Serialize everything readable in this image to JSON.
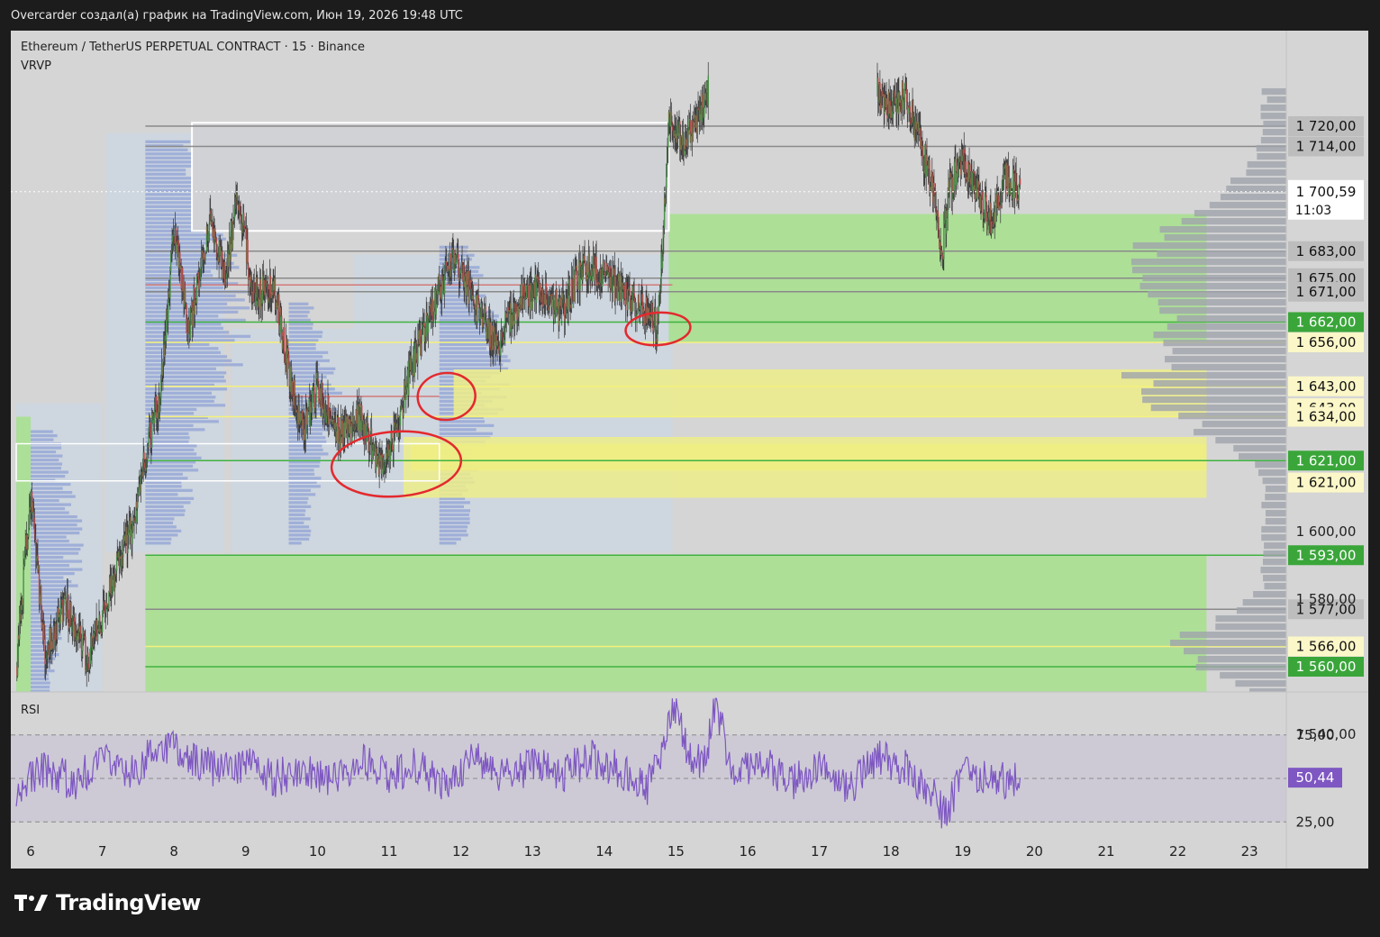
{
  "header": {
    "caption": "Overcarder создал(а) график на TradingView.com, Июн 19, 2026 19:48 UTC"
  },
  "legend": {
    "symbol": "Ethereum / TetherUS PERPETUAL CONTRACT · 15 · Binance",
    "indicator": "VRVP"
  },
  "rsi_panel": {
    "label": "RSI",
    "current_value": "50,44",
    "upper_level": "75,00",
    "lower_level": "25,00"
  },
  "footer": {
    "brand": "TradingView"
  },
  "colors": {
    "background": "#d5d5d5",
    "green_zone": "#a6e08c",
    "yellow_zone": "#eded8a",
    "bright_yellow": "#f3f25a",
    "volume_profile": "#8fa2d6",
    "rsi_line": "#7e57c2",
    "candle_up": "#4a8f4a",
    "candle_down": "#b34a4a",
    "annotation": "#e3292e"
  },
  "chart_data": [
    {
      "type": "candlestick",
      "title": "Ethereum / TetherUS PERPETUAL CONTRACT · 15 · Binance",
      "x_tick_labels": [
        "6",
        "7",
        "8",
        "9",
        "10",
        "11",
        "12",
        "13",
        "14",
        "15",
        "16",
        "17",
        "18",
        "19",
        "20",
        "21",
        "22",
        "23"
      ],
      "y_tick_labels": [
        "1 600,00",
        "1 580,00",
        "1 540,00"
      ],
      "ylim": [
        1530,
        1730
      ],
      "price_axis_labels": [
        {
          "value": 1720.0,
          "text": "1 720,00",
          "style": "gray"
        },
        {
          "value": 1714.0,
          "text": "1 714,00",
          "style": "gray"
        },
        {
          "value": 1683.0,
          "text": "1 683,00",
          "style": "gray"
        },
        {
          "value": 1675.0,
          "text": "1 675,00",
          "style": "gray"
        },
        {
          "value": 1671.0,
          "text": "1 671,00",
          "style": "gray"
        },
        {
          "value": 1662.0,
          "text": "1 662,00",
          "style": "green"
        },
        {
          "value": 1656.0,
          "text": "1 656,00",
          "style": "yellow"
        },
        {
          "value": 1643.0,
          "text": "1 643,00",
          "style": "yellow"
        },
        {
          "value": 1636.5,
          "text": "1 643,00",
          "style": "yellow"
        },
        {
          "value": 1634.0,
          "text": "1 634,00",
          "style": "yellow"
        },
        {
          "value": 1621.0,
          "text": "1 621,00",
          "style": "green"
        },
        {
          "value": 1614.5,
          "text": "1 621,00",
          "style": "yellow"
        },
        {
          "value": 1593.0,
          "text": "1 593,00",
          "style": "green"
        },
        {
          "value": 1577.0,
          "text": "1 577,00",
          "style": "gray"
        },
        {
          "value": 1566.0,
          "text": "1 566,00",
          "style": "yellow"
        },
        {
          "value": 1560.0,
          "text": "1 560,00",
          "style": "green"
        }
      ],
      "last_price": {
        "value": 1700.59,
        "text": "1 700,59",
        "countdown": "11:03"
      },
      "zones": [
        {
          "color": "green",
          "from_day": 14.9,
          "to_day": 22.4,
          "low": 1656,
          "high": 1694
        },
        {
          "color": "yellow",
          "from_day": 11.9,
          "to_day": 22.4,
          "low": 1634,
          "high": 1648
        },
        {
          "color": "bright_yellow",
          "from_day": 11.3,
          "to_day": 22.4,
          "low": 1618,
          "high": 1626
        },
        {
          "color": "yellow",
          "from_day": 11.2,
          "to_day": 22.4,
          "low": 1610,
          "high": 1628
        },
        {
          "color": "green",
          "from_day": 7.6,
          "to_day": 22.4,
          "low": 1547,
          "high": 1593
        },
        {
          "color": "green",
          "from_day": 5.8,
          "to_day": 6.0,
          "low": 1549,
          "high": 1634
        }
      ],
      "horizontal_levels": [
        1720,
        1714,
        1683,
        1675,
        1671,
        1662,
        1656,
        1643,
        1634,
        1621,
        1593,
        1577,
        1566,
        1560
      ],
      "price_path": [
        {
          "day": 5.8,
          "price": 1560
        },
        {
          "day": 6.0,
          "price": 1610
        },
        {
          "day": 6.2,
          "price": 1565
        },
        {
          "day": 6.5,
          "price": 1578
        },
        {
          "day": 6.8,
          "price": 1562
        },
        {
          "day": 7.0,
          "price": 1575
        },
        {
          "day": 7.2,
          "price": 1590
        },
        {
          "day": 7.4,
          "price": 1600
        },
        {
          "day": 7.6,
          "price": 1622
        },
        {
          "day": 7.8,
          "price": 1640
        },
        {
          "day": 8.0,
          "price": 1690
        },
        {
          "day": 8.2,
          "price": 1660
        },
        {
          "day": 8.5,
          "price": 1692
        },
        {
          "day": 8.7,
          "price": 1675
        },
        {
          "day": 8.9,
          "price": 1700
        },
        {
          "day": 9.1,
          "price": 1670
        },
        {
          "day": 9.4,
          "price": 1672
        },
        {
          "day": 9.6,
          "price": 1648
        },
        {
          "day": 9.8,
          "price": 1630
        },
        {
          "day": 10.0,
          "price": 1643
        },
        {
          "day": 10.3,
          "price": 1628
        },
        {
          "day": 10.6,
          "price": 1634
        },
        {
          "day": 10.9,
          "price": 1618
        },
        {
          "day": 11.1,
          "price": 1630
        },
        {
          "day": 11.3,
          "price": 1648
        },
        {
          "day": 11.5,
          "price": 1660
        },
        {
          "day": 11.7,
          "price": 1672
        },
        {
          "day": 11.9,
          "price": 1682
        },
        {
          "day": 12.2,
          "price": 1668
        },
        {
          "day": 12.5,
          "price": 1655
        },
        {
          "day": 12.8,
          "price": 1668
        },
        {
          "day": 13.1,
          "price": 1672
        },
        {
          "day": 13.4,
          "price": 1665
        },
        {
          "day": 13.7,
          "price": 1678
        },
        {
          "day": 14.0,
          "price": 1676
        },
        {
          "day": 14.2,
          "price": 1672
        },
        {
          "day": 14.4,
          "price": 1668
        },
        {
          "day": 14.6,
          "price": 1665
        },
        {
          "day": 14.75,
          "price": 1660
        },
        {
          "day": 14.9,
          "price": 1720
        },
        {
          "day": 15.1,
          "price": 1716
        },
        {
          "day": 15.3,
          "price": 1722
        },
        {
          "day": 15.45,
          "price": 1730
        },
        {
          "day": 17.8,
          "price": 1730
        },
        {
          "day": 18.0,
          "price": 1726
        },
        {
          "day": 18.2,
          "price": 1730
        },
        {
          "day": 18.6,
          "price": 1700
        },
        {
          "day": 18.7,
          "price": 1680
        },
        {
          "day": 18.8,
          "price": 1700
        },
        {
          "day": 19.0,
          "price": 1712
        },
        {
          "day": 19.2,
          "price": 1700
        },
        {
          "day": 19.4,
          "price": 1692
        },
        {
          "day": 19.6,
          "price": 1705
        },
        {
          "day": 19.8,
          "price": 1700
        }
      ]
    },
    {
      "type": "line",
      "title": "RSI",
      "y_tick_labels": [
        "75,00",
        "25,00"
      ],
      "ylim": [
        10,
        100
      ],
      "bands": [
        25,
        75
      ],
      "current": 50.44,
      "x": [
        5.8,
        6.2,
        6.6,
        7.0,
        7.4,
        7.8,
        8.2,
        8.6,
        9.0,
        9.4,
        9.8,
        10.2,
        10.6,
        11.0,
        11.4,
        11.8,
        12.2,
        12.6,
        13.0,
        13.4,
        13.8,
        14.2,
        14.6,
        14.8,
        14.95,
        15.2,
        15.4,
        15.55,
        15.8,
        16.2,
        16.6,
        17.0,
        17.4,
        17.8,
        18.2,
        18.6,
        18.75,
        19.0,
        19.4,
        19.8
      ],
      "values": [
        45,
        55,
        48,
        60,
        52,
        70,
        62,
        55,
        58,
        50,
        56,
        48,
        60,
        52,
        58,
        46,
        62,
        50,
        58,
        52,
        62,
        55,
        45,
        65,
        92,
        62,
        60,
        93,
        52,
        60,
        48,
        56,
        44,
        62,
        56,
        40,
        28,
        55,
        48,
        50.44
      ]
    }
  ]
}
